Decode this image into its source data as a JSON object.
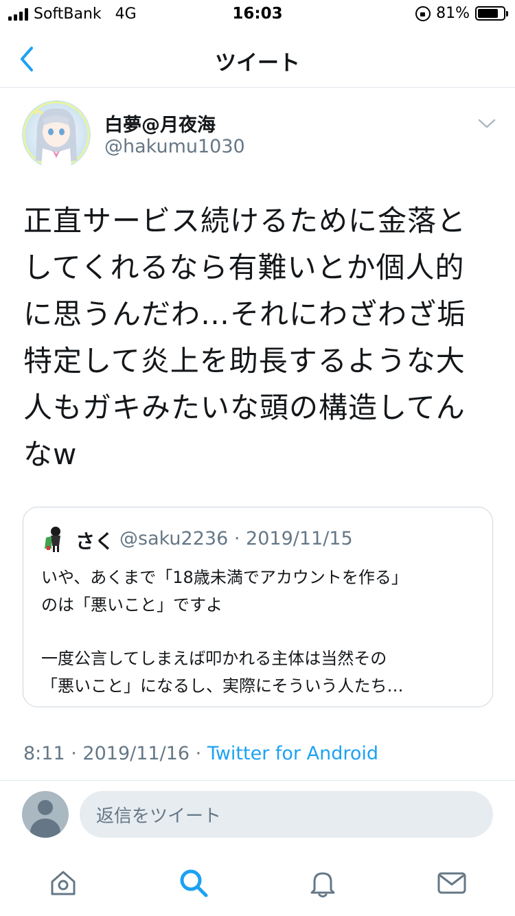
{
  "status_bar": {
    "carrier": "SoftBank",
    "network": "4G",
    "time": "16:03",
    "battery_percent": "81%",
    "battery_level": 0.81
  },
  "nav": {
    "back_icon": "chevron-left-icon",
    "title": "ツイート"
  },
  "tweet": {
    "display_name": "白夢@月夜海",
    "handle": "@hakumu1030",
    "text_lines": [
      "正直サービス続けるために金落と",
      "してくれるなら有難いとか個人的",
      "に思うんだわ…それにわざわざ垢",
      "特定して炎上を助長するような大",
      "人もガキみたいな頭の構造してん",
      "なw"
    ],
    "time": "8:11",
    "date": "2019/11/16",
    "separator": "·",
    "source": "Twitter for Android"
  },
  "quoted_tweet": {
    "display_name": "さく",
    "handle": "@saku2236",
    "separator": "·",
    "date": "2019/11/15",
    "text_lines": [
      "いや、あくまで「18歳未満でアカウントを作る」",
      "のは「悪いこと」ですよ",
      "一度公言してしまえば叩かれる主体は当然その",
      "「悪いこと」になるし、実際にそういう人たち…"
    ]
  },
  "reply": {
    "placeholder": "返信をツイート"
  },
  "tab_bar": {
    "items": [
      "home-icon",
      "search-icon",
      "notifications-icon",
      "messages-icon"
    ],
    "active_color": "#1da1f2",
    "inactive_color": "#657786"
  }
}
